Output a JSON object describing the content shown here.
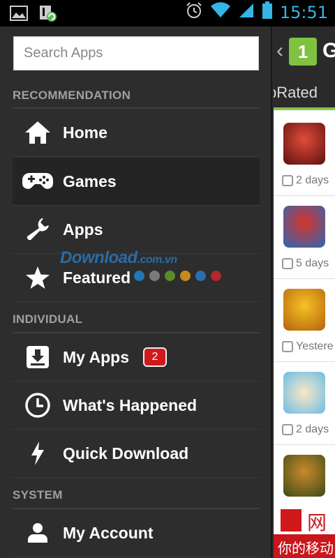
{
  "status_bar": {
    "time": "15:51",
    "icons": [
      "image-icon",
      "app-update-icon",
      "alarm-icon",
      "wifi-icon",
      "signal-icon",
      "battery-icon"
    ]
  },
  "drawer": {
    "search": {
      "placeholder": "Search Apps",
      "value": ""
    },
    "sections": [
      {
        "title": "RECOMMENDATION"
      },
      {
        "title": "INDIVIDUAL"
      },
      {
        "title": "SYSTEM"
      }
    ],
    "items": {
      "home": {
        "label": "Home",
        "icon": "home-icon"
      },
      "games": {
        "label": "Games",
        "icon": "gamepad-icon",
        "selected": true
      },
      "apps": {
        "label": "Apps",
        "icon": "wrench-icon"
      },
      "featured": {
        "label": "Featured",
        "icon": "star-icon"
      },
      "my_apps": {
        "label": "My Apps",
        "icon": "download-icon",
        "badge": "2"
      },
      "whats_happened": {
        "label": "What's Happened",
        "icon": "clock-icon"
      },
      "quick_download": {
        "label": "Quick Download",
        "icon": "lightning-icon"
      },
      "my_account": {
        "label": "My Account",
        "icon": "person-icon"
      }
    },
    "page_dots": [
      "#1f78b4",
      "#7a7a7a",
      "#5c8a2a",
      "#c48a1e",
      "#2a6fb0",
      "#b3262a"
    ]
  },
  "watermark": {
    "main": "Download",
    "suffix": ".com.vn"
  },
  "right_panel": {
    "header_logo_text": "1",
    "header_title_partial": "G",
    "tab_partial": "pRated",
    "cards": [
      {
        "time": "2 days",
        "thumb_color": "#a8231f"
      },
      {
        "time": "5 days",
        "thumb_color": "#3a78c8"
      },
      {
        "time": "Yestere",
        "thumb_color": "#e0a11b"
      },
      {
        "time": "2 days",
        "thumb_color": "#7ec5e8"
      },
      {
        "time": "",
        "thumb_color": "#6b7a2b"
      }
    ],
    "ad_line1": "网易",
    "ad_line2": "你的移动"
  },
  "colors": {
    "accent_blue": "#33b5e5",
    "drawer_bg": "#2d2d2d",
    "badge_red": "#d0181d",
    "tab_green": "#8bc34a"
  }
}
